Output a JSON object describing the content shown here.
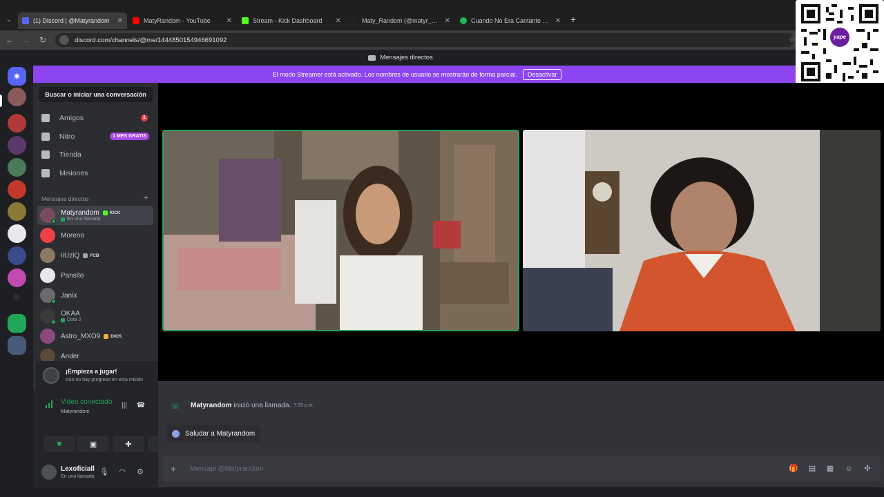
{
  "browser": {
    "tabs": [
      {
        "title": "(1) Discord | @Matyrandom",
        "color": "#5865f2"
      },
      {
        "title": "MatyRandom - YouTube",
        "color": "#ff0000"
      },
      {
        "title": "Stream - Kick Dashboard",
        "color": "#53fc18"
      },
      {
        "title": "Maty_Random (@matyr_andom",
        "color": "#222222"
      },
      {
        "title": "Cuando No Era Cantante • El B",
        "color": "#1db954"
      }
    ],
    "url": "discord.com/channels/@me/1444850154946691092"
  },
  "discord": {
    "title": "Mensajes directos",
    "streamer_banner": "El modo Streamer está activado. Los nombres de usuario se mostrarán de forma parcial.",
    "streamer_button": "Desactivar",
    "search": "Buscar o iniciar una conversación",
    "nav": [
      {
        "label": "Amigos",
        "badge": "1"
      },
      {
        "label": "Nitro",
        "badge": "1 MES GRATIS"
      },
      {
        "label": "Tienda"
      },
      {
        "label": "Misiones"
      }
    ],
    "dm_header": "Mensajes directos",
    "dms": [
      {
        "name": "Matyrandom",
        "tag": "KICK",
        "sub": "En una llamada",
        "color": "#7a4b5c"
      },
      {
        "name": "Moreno",
        "color": "#ed4245"
      },
      {
        "name": "IiUziQ",
        "tag": "FCB",
        "color": "#8b7a63"
      },
      {
        "name": "Pansito",
        "color": "#e8e8e8"
      },
      {
        "name": "Janix",
        "color": "#6b6b6b"
      },
      {
        "name": "OKAA",
        "sub": "Dota 2",
        "color": "#3a3a3a"
      },
      {
        "name": "Astro_MXO9",
        "tag": "DIOS",
        "color": "#8a4a7a"
      },
      {
        "name": "Ander",
        "color": "#5a4a3a"
      }
    ],
    "quest": {
      "title": "¡Empieza a jugar!",
      "subtitle": "Aún no hay progreso en esta misión"
    },
    "voice": {
      "status": "Video conectado",
      "channel": "Matyrandom"
    },
    "user": {
      "name": "Lexoficiall",
      "status": "En una llamada"
    },
    "chat": {
      "caller": "Matyrandom",
      "call_text": "inició una llamada.",
      "time": "7:39 p.m.",
      "wave_button": "Saludar a Matyrandom",
      "composer_placeholder": "Mensaje @Matyrandom"
    }
  },
  "overlay": {
    "qr_logo": "yape"
  }
}
